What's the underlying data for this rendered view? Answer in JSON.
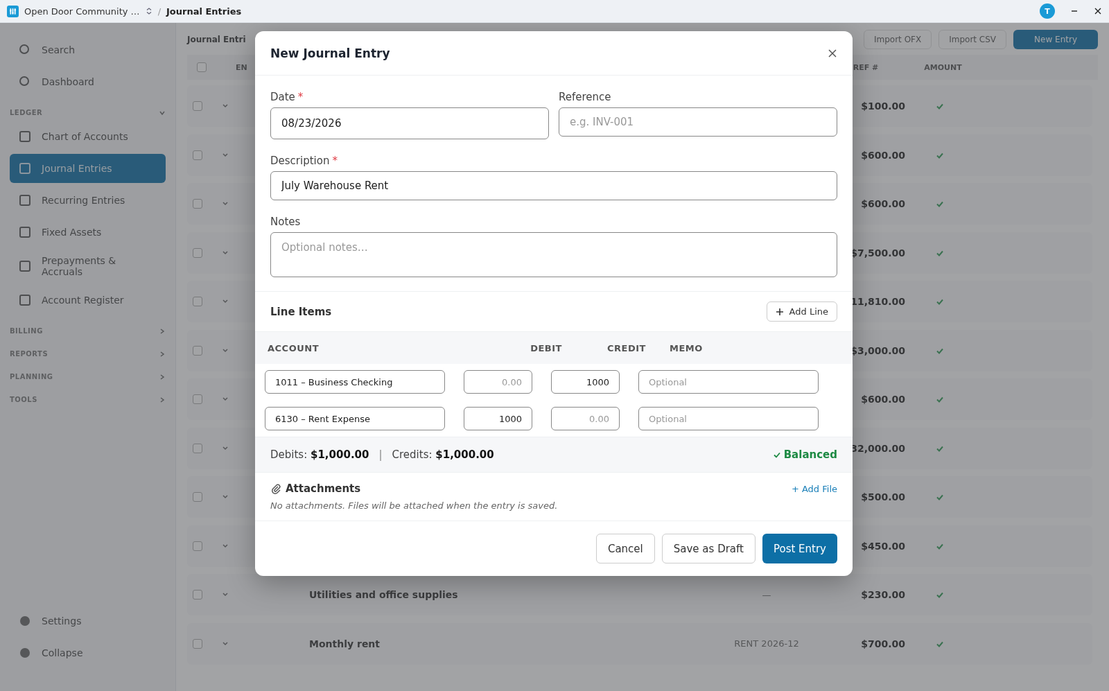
{
  "titlebar": {
    "workspace": "Open Door Community …",
    "separator": "/",
    "page": "Journal Entries",
    "avatar": "T"
  },
  "sidebar": {
    "top": [
      {
        "label": "Search"
      },
      {
        "label": "Dashboard"
      }
    ],
    "sections": [
      {
        "label": "LEDGER",
        "expanded": true,
        "items": [
          {
            "label": "Chart of Accounts",
            "selected": false
          },
          {
            "label": "Journal Entries",
            "selected": true
          },
          {
            "label": "Recurring Entries",
            "selected": false
          },
          {
            "label": "Fixed Assets",
            "selected": false
          },
          {
            "label": "Prepayments & Accruals",
            "selected": false
          },
          {
            "label": "Account Register",
            "selected": false
          }
        ]
      },
      {
        "label": "BILLING",
        "expanded": false
      },
      {
        "label": "REPORTS",
        "expanded": false
      },
      {
        "label": "PLANNING",
        "expanded": false
      },
      {
        "label": "TOOLS",
        "expanded": false
      }
    ],
    "bottom": [
      {
        "label": "Settings"
      },
      {
        "label": "Collapse"
      }
    ]
  },
  "page": {
    "title": "Journal Entri",
    "actions": [
      {
        "label": "Import OFX",
        "kind": "outline"
      },
      {
        "label": "Import CSV",
        "kind": "outline"
      },
      {
        "label": "New Entry",
        "kind": "primary"
      }
    ],
    "all_checked": false,
    "columns": [
      "EN",
      "REF #",
      "AMOUNT"
    ],
    "rows": [
      {
        "checked": false,
        "amount": "$100.00",
        "balanced": true
      },
      {
        "checked": false,
        "amount": "$600.00",
        "balanced": true
      },
      {
        "checked": false,
        "amount": "$600.00",
        "balanced": true
      },
      {
        "checked": false,
        "amount": "$7,500.00",
        "balanced": true
      },
      {
        "checked": false,
        "amount": "11,810.00",
        "balanced": true
      },
      {
        "checked": false,
        "amount": "$3,000.00",
        "balanced": true
      },
      {
        "checked": false,
        "amount": "$600.00",
        "balanced": true
      },
      {
        "checked": false,
        "amount": "32,000.00",
        "balanced": true
      },
      {
        "checked": false,
        "amount": "$500.00",
        "balanced": true
      },
      {
        "checked": false,
        "amount": "$450.00",
        "balanced": true
      },
      {
        "checked": false,
        "description": "Utilities and office supplies",
        "ref": "—",
        "amount": "$230.00",
        "balanced": true
      },
      {
        "checked": false,
        "description": "Monthly rent",
        "ref": "RENT 2026-12",
        "amount": "$700.00",
        "balanced": true
      }
    ]
  },
  "modal": {
    "title": "New Journal Entry",
    "date": {
      "label": "Date",
      "required_mark": "*",
      "value": "08/23/2026"
    },
    "reference": {
      "label": "Reference",
      "placeholder": "e.g. INV-001"
    },
    "description": {
      "label": "Description",
      "required_mark": "*",
      "value": "July Warehouse Rent"
    },
    "notes": {
      "label": "Notes",
      "placeholder": "Optional notes…"
    },
    "line_items": {
      "title": "Line Items",
      "add_label": "Add Line",
      "columns": [
        "ACCOUNT",
        "DEBIT",
        "CREDIT",
        "MEMO"
      ],
      "rows": [
        {
          "account": "1011 – Business Checking",
          "debit_placeholder": "0.00",
          "credit": "1000",
          "memo_placeholder": "Optional"
        },
        {
          "account": "6130 – Rent Expense",
          "debit": "1000",
          "credit_placeholder": "0.00",
          "memo_placeholder": "Optional"
        }
      ]
    },
    "totals": {
      "debits_label": "Debits:",
      "debits": "$1,000.00",
      "separator": "|",
      "credits_label": "Credits:",
      "credits": "$1,000.00",
      "status": "Balanced",
      "balanced": true
    },
    "attachments": {
      "title": "Attachments",
      "add_label": "+ Add File",
      "empty": "No attachments. Files will be attached when the entry is saved."
    },
    "buttons": [
      {
        "label": "Cancel",
        "kind": "secondary"
      },
      {
        "label": "Save as Draft",
        "kind": "secondary"
      },
      {
        "label": "Post Entry",
        "kind": "primary"
      }
    ]
  }
}
